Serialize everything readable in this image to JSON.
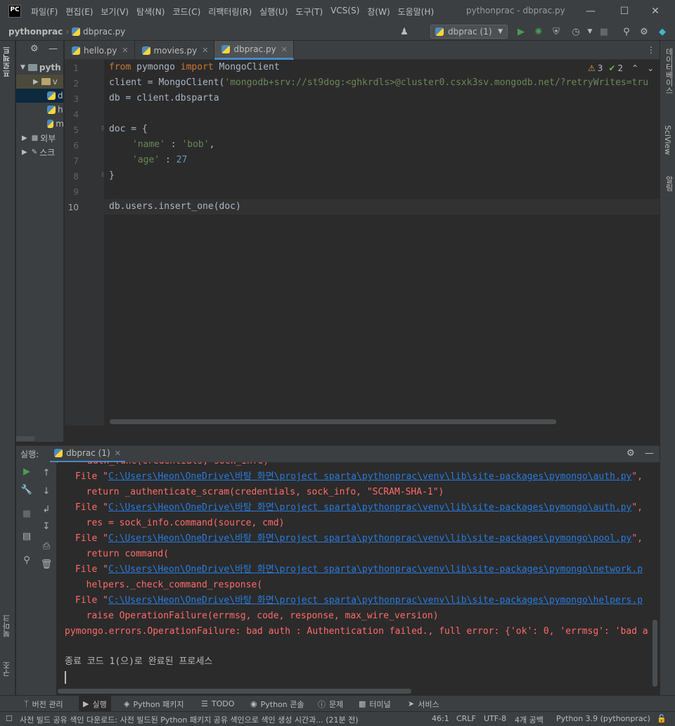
{
  "app": {
    "logo_text": "PC",
    "window_title": "pythonprac - dbprac.py",
    "menu": [
      "파일(F)",
      "편집(E)",
      "보기(V)",
      "탐색(N)",
      "코드(C)",
      "리팩터링(R)",
      "실행(U)",
      "도구(T)",
      "VCS(S)",
      "창(W)",
      "도움말(H)"
    ]
  },
  "navbar": {
    "project": "pythonprac",
    "file": "dbprac.py",
    "run_config": "dbprac (1)"
  },
  "left_strip": {
    "project_tab": "프로젝트",
    "bookmarks_tab": "북마크",
    "structure_tab": "구조"
  },
  "right_strip": {
    "database_tab": "데이터베이스",
    "sciview_tab": "SciView",
    "notifications_tab": "알림"
  },
  "project_tree": {
    "items": [
      {
        "label": "pyth"
      },
      {
        "label": "v"
      },
      {
        "label": "d"
      },
      {
        "label": "h"
      },
      {
        "label": "m"
      },
      {
        "label": "외부"
      },
      {
        "label": "스크"
      }
    ]
  },
  "editor": {
    "tabs": [
      {
        "label": "hello.py",
        "active": false
      },
      {
        "label": "movies.py",
        "active": false
      },
      {
        "label": "dbprac.py",
        "active": true
      }
    ],
    "line_numbers": [
      "1",
      "2",
      "3",
      "4",
      "5",
      "6",
      "7",
      "8",
      "9",
      "10"
    ],
    "inspections": {
      "warnings": "3",
      "typos": "2"
    },
    "code": {
      "l1_kw1": "from",
      "l1_mod": " pymongo ",
      "l1_kw2": "import",
      "l1_name": " MongoClient",
      "l2_pre": "client = MongoClient(",
      "l2_str": "'mongodb+srv://st9dog:<ghkrdls>@cluster0.csxk3sv.mongodb.net/?retryWrites=tru",
      "l3": "db = client.dbsparta",
      "l5": "doc = {",
      "l6_str1": "'name'",
      "l6_mid": " : ",
      "l6_str2": "'bob'",
      "l6_end": ",",
      "l7_str": "'age'",
      "l7_mid": " : ",
      "l7_num": "27",
      "l8": "}",
      "l10": "db.users.insert_one(doc)"
    }
  },
  "run_panel": {
    "label": "실행:",
    "tab": "dbprac (1)",
    "console": {
      "l0": "auth_func(credentials, sock_info)",
      "file_prefix": "File \"",
      "l1_path": "C:\\Users\\Heon\\OneDrive\\바탕 화면\\project sparta\\pythonprac\\venv\\lib\\site-packages\\pymongo\\auth.py",
      "l1_tail": "\",",
      "l2": "  return _authenticate_scram(credentials, sock_info, \"SCRAM-SHA-1\")",
      "l3_path": "C:\\Users\\Heon\\OneDrive\\바탕 화면\\project sparta\\pythonprac\\venv\\lib\\site-packages\\pymongo\\auth.py",
      "l3_tail": "\",",
      "l4": "  res = sock_info.command(source, cmd)",
      "l5_path": "C:\\Users\\Heon\\OneDrive\\바탕 화면\\project sparta\\pythonprac\\venv\\lib\\site-packages\\pymongo\\pool.py",
      "l5_tail": "\",",
      "l6": "  return command(",
      "l7_path": "C:\\Users\\Heon\\OneDrive\\바탕 화면\\project sparta\\pythonprac\\venv\\lib\\site-packages\\pymongo\\network.p",
      "l8": "  helpers._check_command_response(",
      "l9_path": "C:\\Users\\Heon\\OneDrive\\바탕 화면\\project sparta\\pythonprac\\venv\\lib\\site-packages\\pymongo\\helpers.p",
      "l10": "  raise OperationFailure(errmsg, code, response, max_wire_version)",
      "l11": "pymongo.errors.OperationFailure: bad auth : Authentication failed., full error: {'ok': 0, 'errmsg': 'bad a",
      "l13": "종료 코드 1(으)로 완료된 프로세스"
    }
  },
  "tool_tabs": [
    "버전 관리",
    "실행",
    "Python 패키지",
    "TODO",
    "Python 콘솔",
    "문제",
    "터미널",
    "서비스"
  ],
  "statusbar": {
    "message": "사전 빌드 공유 색인 다운로드: 사전 빌드된 Python 패키지 공유 색인으로 색인 생성 시간과... (21분 전)",
    "position": "46:1",
    "line_sep": "CRLF",
    "encoding": "UTF-8",
    "indent": "4개 공백",
    "interpreter": "Python 3.9 (pythonprac)"
  }
}
